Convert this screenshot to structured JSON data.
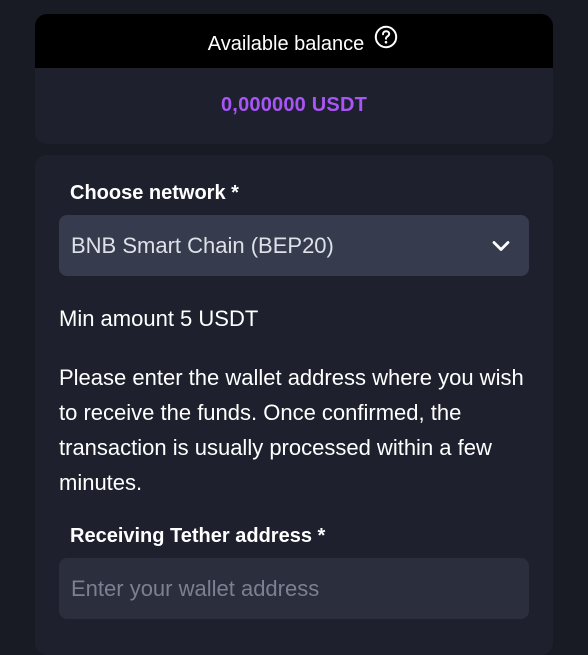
{
  "balance": {
    "label": "Available balance",
    "help_icon": "question-circle-icon",
    "value": "0,000000 USDT",
    "value_color": "#a855f7"
  },
  "network": {
    "label": "Choose network *",
    "selected": "BNB Smart Chain (BEP20)",
    "chevron_icon": "chevron-down-icon"
  },
  "min_amount": "Min amount 5 USDT",
  "instructions": "Please enter the wallet address where you wish to receive the funds. Once confirmed, the transaction is usually processed within a few minutes.",
  "address": {
    "label": "Receiving Tether address *",
    "value": "",
    "placeholder": "Enter your wallet address"
  }
}
